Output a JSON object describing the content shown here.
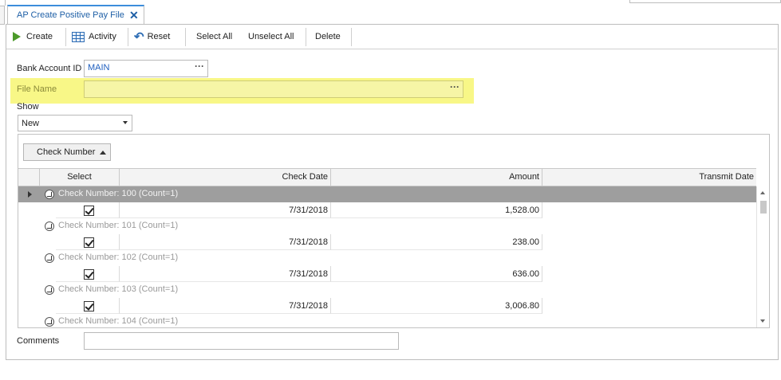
{
  "tab": {
    "title": "AP Create Positive Pay File",
    "close": "✕"
  },
  "toolbar": {
    "create": "Create",
    "activity": "Activity",
    "reset": "Reset",
    "select_all": "Select All",
    "unselect_all": "Unselect All",
    "delete": "Delete"
  },
  "form": {
    "bank_account_label": "Bank Account ID",
    "bank_account_value": "MAIN",
    "file_name_label": "File Name",
    "file_name_value": "",
    "show_label": "Show",
    "show_value": "New",
    "comments_label": "Comments",
    "comments_value": "",
    "dots": "···"
  },
  "grid": {
    "group_by_chip": "Check Number",
    "columns": [
      "Select",
      "Check Date",
      "Amount",
      "Transmit Date"
    ],
    "groups": [
      {
        "label": "Check Number: 100 (Count=1)",
        "check_date": "7/31/2018",
        "amount": "1,528.00",
        "transmit_date": ""
      },
      {
        "label": "Check Number: 101 (Count=1)",
        "check_date": "7/31/2018",
        "amount": "238.00",
        "transmit_date": ""
      },
      {
        "label": "Check Number: 102 (Count=1)",
        "check_date": "7/31/2018",
        "amount": "636.00",
        "transmit_date": ""
      },
      {
        "label": "Check Number: 103 (Count=1)",
        "check_date": "7/31/2018",
        "amount": "3,006.80",
        "transmit_date": ""
      },
      {
        "label": "Check Number: 104 (Count=1)"
      }
    ]
  },
  "colors": {
    "accent": "#3c8ddb",
    "highlight": "#f7f67a",
    "selected_group_row": "#9e9e9e"
  }
}
